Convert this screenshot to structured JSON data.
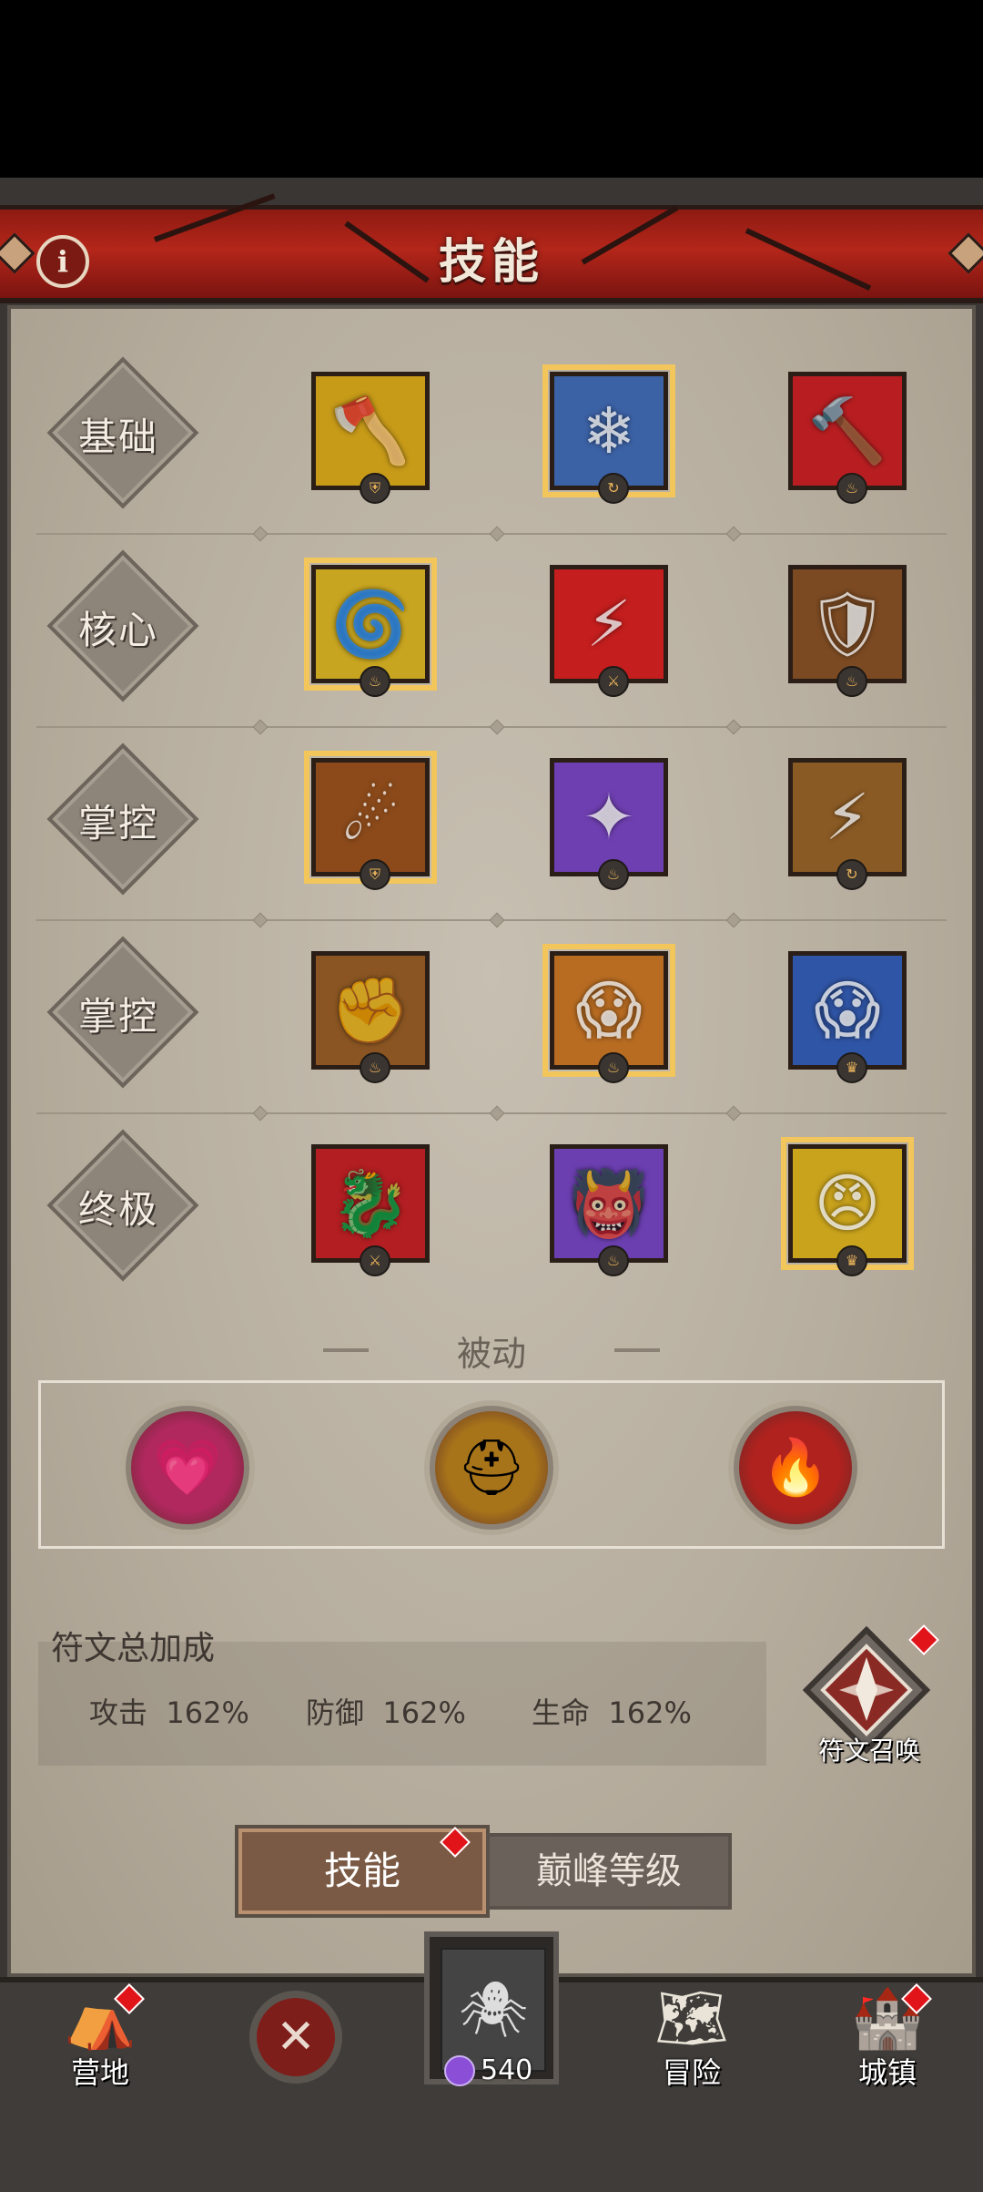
{
  "header": {
    "title": "技能",
    "info_label": "i"
  },
  "rows": [
    {
      "label": "基础",
      "skills": [
        {
          "icon": "axe-icon",
          "glyph": "🪓",
          "bg": "#c79a18",
          "badge": "shield"
        },
        {
          "icon": "frost-axe-icon",
          "glyph": "❄",
          "bg": "#3c62a6",
          "badge": "swirl",
          "selected": true
        },
        {
          "icon": "fire-hammer-icon",
          "glyph": "🔨",
          "bg": "#b81e21",
          "badge": "flame"
        }
      ]
    },
    {
      "label": "核心",
      "skills": [
        {
          "icon": "whirlwind-icon",
          "glyph": "🌀",
          "bg": "#c8a520",
          "badge": "flame",
          "selected": true
        },
        {
          "icon": "rend-icon",
          "glyph": "⚡",
          "bg": "#c41e1e",
          "badge": "claw"
        },
        {
          "icon": "totem-icon",
          "glyph": "🛡",
          "bg": "#7b4a22",
          "badge": "flame"
        }
      ]
    },
    {
      "label": "掌控",
      "skills": [
        {
          "icon": "meteor-icon",
          "glyph": "☄",
          "bg": "#8c4a1a",
          "badge": "shield",
          "selected": true
        },
        {
          "icon": "shadow-burst-icon",
          "glyph": "✦",
          "bg": "#6e3fb0",
          "badge": "flame"
        },
        {
          "icon": "earth-split-icon",
          "glyph": "⚡",
          "bg": "#8a5a24",
          "badge": "swirl"
        }
      ]
    },
    {
      "label": "掌控",
      "skills": [
        {
          "icon": "ground-slam-icon",
          "glyph": "✊",
          "bg": "#8a5522",
          "badge": "flame"
        },
        {
          "icon": "war-cry-icon",
          "glyph": "😱",
          "bg": "#b86c22",
          "badge": "flame",
          "selected": true
        },
        {
          "icon": "ice-roar-icon",
          "glyph": "😱",
          "bg": "#2f55a6",
          "badge": "crown"
        }
      ]
    },
    {
      "label": "终极",
      "skills": [
        {
          "icon": "dragon-slash-icon",
          "glyph": "🐉",
          "bg": "#b21e21",
          "badge": "claw"
        },
        {
          "icon": "demon-icon",
          "glyph": "👹",
          "bg": "#6b3fb0",
          "badge": "flame"
        },
        {
          "icon": "berserk-icon",
          "glyph": "😠",
          "bg": "#c9a31c",
          "badge": "crown",
          "selected": true
        }
      ]
    }
  ],
  "passive": {
    "title": "被动",
    "items": [
      {
        "icon": "bleeding-heart-icon",
        "glyph": "💗",
        "bg": "#b0285e"
      },
      {
        "icon": "horned-helmet-icon",
        "glyph": "⛑",
        "bg": "#a8741a"
      },
      {
        "icon": "flame-face-icon",
        "glyph": "🔥",
        "bg": "#b0221e"
      }
    ]
  },
  "rune": {
    "title": "符文总加成",
    "stats": [
      {
        "label": "攻击",
        "value": "162%"
      },
      {
        "label": "防御",
        "value": "162%"
      },
      {
        "label": "生命",
        "value": "162%"
      }
    ],
    "summon_label": "符文召唤"
  },
  "tabs": {
    "active": "技能",
    "inactive": "巅峰等级"
  },
  "nav": {
    "camp": "营地",
    "adventure": "冒险",
    "town": "城镇",
    "gems": "540"
  },
  "colors": {
    "accent_gold": "#f2c65b",
    "header_red": "#b4261a",
    "badge_red": "#e1141a"
  }
}
